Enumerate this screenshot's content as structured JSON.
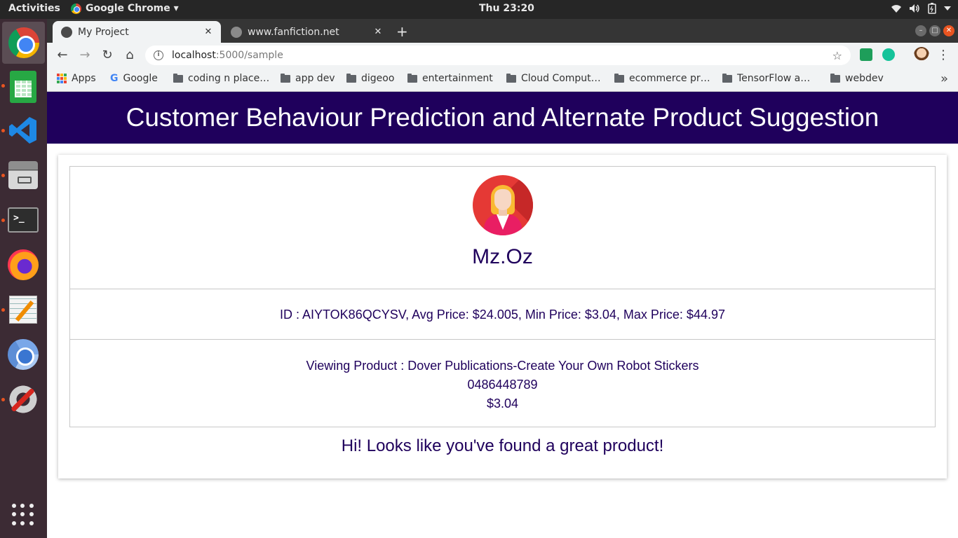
{
  "system": {
    "activities": "Activities",
    "app_menu": "Google Chrome ▾",
    "clock": "Thu 23:20",
    "tray": [
      "wifi-icon",
      "volume-icon",
      "battery-icon",
      "chevron-down-icon"
    ]
  },
  "dock": {
    "items": [
      "chrome-icon",
      "libreoffice-calc-icon",
      "vscode-icon",
      "files-icon",
      "terminal-icon",
      "firefox-icon",
      "text-editor-icon",
      "chromium-icon",
      "system-tools-icon",
      "show-applications-icon"
    ]
  },
  "browser": {
    "tabs": [
      {
        "title": "My Project",
        "active": true
      },
      {
        "title": "www.fanfiction.net",
        "active": false
      }
    ],
    "url_host": "localhost",
    "url_path": ":5000/sample",
    "bookmarks": [
      {
        "label": "Apps",
        "icon": "apps-grid-icon"
      },
      {
        "label": "Google",
        "icon": "google-icon"
      },
      {
        "label": "coding n place…",
        "icon": "folder-icon"
      },
      {
        "label": "app dev",
        "icon": "folder-icon"
      },
      {
        "label": "digeoo",
        "icon": "folder-icon"
      },
      {
        "label": "entertainment",
        "icon": "folder-icon"
      },
      {
        "label": "Cloud Comput…",
        "icon": "folder-icon"
      },
      {
        "label": "ecommerce pr…",
        "icon": "folder-icon"
      },
      {
        "label": "TensorFlow a…",
        "icon": "folder-icon"
      },
      {
        "label": "webdev",
        "icon": "folder-icon"
      }
    ],
    "more": "»"
  },
  "page": {
    "banner_title": "Customer Behaviour Prediction and Alternate Product Suggestion",
    "user_name": "Mz.Oz",
    "stats": "ID : AIYTOK86QCYSV, Avg Price: $24.005, Min Price: $3.04, Max Price: $44.97",
    "product_line1": "Viewing Product : Dover Publications-Create Your Own Robot Stickers",
    "product_line2": "0486448789",
    "product_line3": "$3.04",
    "message": "Hi! Looks like you've found a great product!"
  },
  "colors": {
    "banner_bg": "#1f005c",
    "text_primary": "#1f005c",
    "dock_bg": "#3c2b34",
    "ubuntu_orange": "#e95420"
  }
}
